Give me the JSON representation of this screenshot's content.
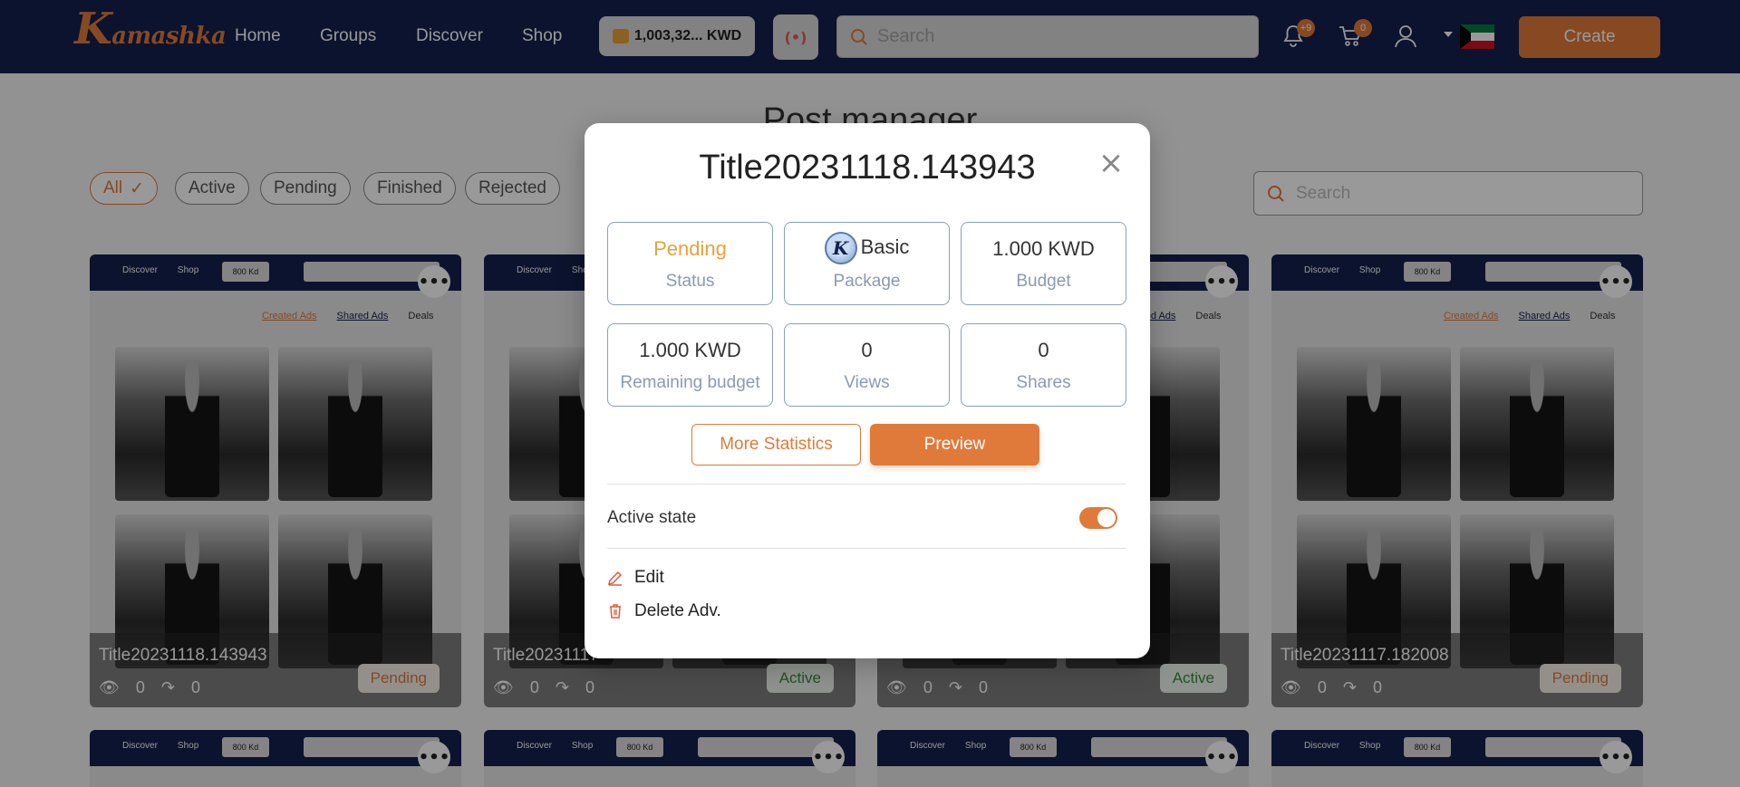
{
  "nav": {
    "logo_text": "Kamashka",
    "links": [
      "Home",
      "Groups",
      "Discover",
      "Shop"
    ],
    "wallet_balance": "1,003,32... KWD",
    "search_placeholder": "Search",
    "notifications_count": "+9",
    "cart_count": "0",
    "create_label": "Create"
  },
  "page": {
    "title": "Post manager",
    "filters": [
      "All",
      "Active",
      "Pending",
      "Finished",
      "Rejected"
    ],
    "search_placeholder": "Search"
  },
  "cards": [
    {
      "title": "Title20231118.143943",
      "views": "0",
      "shares": "0",
      "status": "Pending"
    },
    {
      "title": "Title20231117",
      "views": "0",
      "shares": "0",
      "status": "Active"
    },
    {
      "title": "",
      "views": "0",
      "shares": "0",
      "status": "Active"
    },
    {
      "title": "Title20231117.182008",
      "views": "0",
      "shares": "0",
      "status": "Pending"
    }
  ],
  "card_preview": {
    "mini_nav": [
      "Discover",
      "Shop"
    ],
    "mini_wallet": "800 Kd",
    "mini_tabs": [
      "Created Ads",
      "Shared Ads",
      "Deals"
    ]
  },
  "modal": {
    "title": "Title20231118.143943",
    "stats": [
      {
        "value": "Pending",
        "label": "Status"
      },
      {
        "value": "Basic",
        "label": "Package"
      },
      {
        "value": "1.000 KWD",
        "label": "Budget"
      },
      {
        "value": "1.000 KWD",
        "label": "Remaining budget"
      },
      {
        "value": "0",
        "label": "Views"
      },
      {
        "value": "0",
        "label": "Shares"
      }
    ],
    "more_statistics_label": "More Statistics",
    "preview_label": "Preview",
    "active_state_label": "Active state",
    "active_state_on": true,
    "edit_label": "Edit",
    "delete_label": "Delete Adv."
  },
  "colors": {
    "nav_bg": "#13204d",
    "accent": "#e07a3a",
    "pending": "#e8a23a",
    "active": "#3a8a3a"
  }
}
